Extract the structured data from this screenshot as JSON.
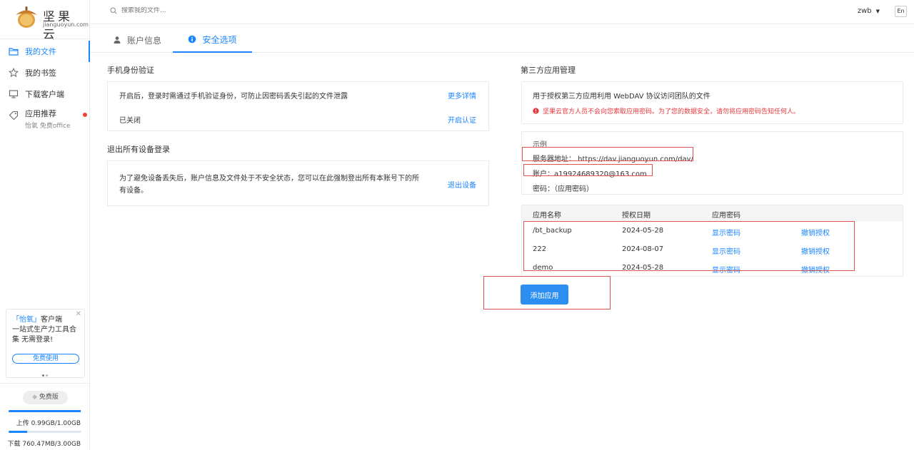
{
  "brand": {
    "name": "坚果云",
    "domain": "jianguoyun.com",
    "accent": "#1a85ff",
    "logo_color": "#d98c32"
  },
  "header": {
    "search_placeholder": "搜索我的文件...",
    "username": "zwb",
    "lang": "En"
  },
  "sidebar": {
    "items": [
      {
        "label": "我的文件",
        "icon": "folder-icon"
      },
      {
        "label": "我的书签",
        "icon": "star-icon"
      },
      {
        "label": "下载客户端",
        "icon": "monitor-icon"
      },
      {
        "label": "应用推荐",
        "sub": "怡氧 免费office",
        "icon": "tag-icon"
      }
    ],
    "promo": {
      "brand": "「怡氧」",
      "text_a": "客户端",
      "text_b": "一站式生产力工具合集 无需登录!",
      "button": "免费使用"
    },
    "plan": "免费版",
    "upload": {
      "label": "上传 0.99GB/1.00GB",
      "ratio": 0.99
    },
    "download": {
      "label": "下载 760.47MB/3.00GB",
      "ratio": 0.25
    }
  },
  "tabs": [
    {
      "label": "账户信息",
      "icon": "user-icon"
    },
    {
      "label": "安全选项",
      "icon": "info-icon"
    }
  ],
  "phone_auth": {
    "title": "手机身份验证",
    "desc": "开启后，登录时需通过手机验证身份，可防止因密码丢失引起的文件泄露",
    "more_link": "更多详情",
    "status": "已关闭",
    "enable_link": "开启认证"
  },
  "logout_all": {
    "title": "退出所有设备登录",
    "desc_line1": "为了避免设备丢失后，账户信息及文件处于不安全状态，您可以在此强制登出所有本账号下的所",
    "desc_line2": "有设备。",
    "action": "退出设备"
  },
  "third_party": {
    "title": "第三方应用管理",
    "desc": "用于授权第三方应用利用 WebDAV 协议访问团队的文件",
    "warning": "坚果云官方人员不会向您索取应用密码。为了您的数据安全，请勿将应用密码告知任何人。",
    "example_label": "示例",
    "server": "服务器地址： https://dav.jianguoyun.com/dav/",
    "account": "账户：a19924689320@163.com",
    "password": "密码：（应用密码）",
    "columns": [
      "应用名称",
      "授权日期",
      "应用密码"
    ],
    "rows": [
      {
        "name": "/bt_backup",
        "date": "2024-05-28",
        "show": "显示密码",
        "revoke": "撤销授权"
      },
      {
        "name": "222",
        "date": "2024-08-07",
        "show": "显示密码",
        "revoke": "撤销授权"
      },
      {
        "name": "demo",
        "date": "2024-05-28",
        "show": "显示密码",
        "revoke": "撤销授权"
      }
    ],
    "add_button": "添加应用"
  }
}
